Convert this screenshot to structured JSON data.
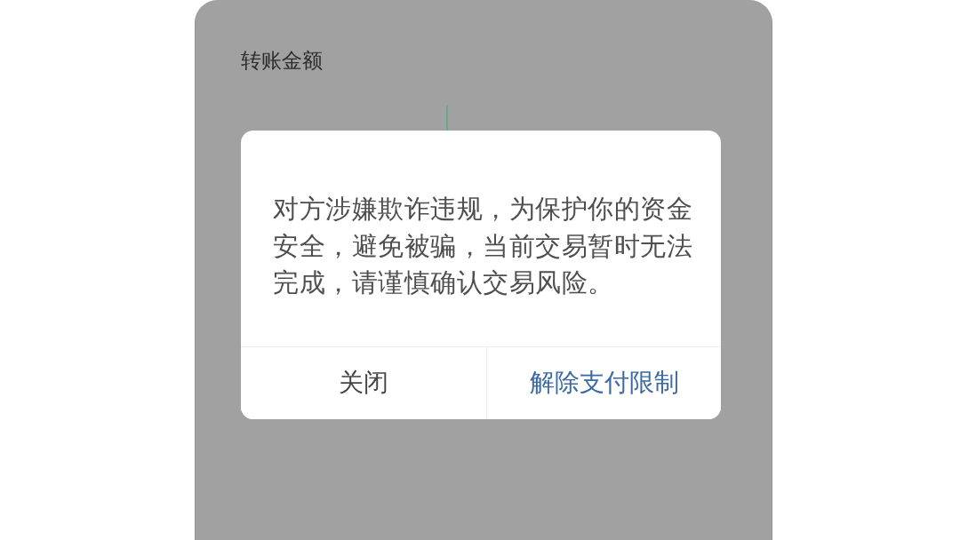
{
  "screen": {
    "field_label": "转账金额",
    "amount": {
      "cursor": true
    }
  },
  "dialog": {
    "message": "对方涉嫌欺诈违规，为保护你的资金安全，避免被骗，当前交易暂时无法完成，请谨慎确认交易风险。",
    "buttons": [
      {
        "label": "关闭",
        "kind": "secondary"
      },
      {
        "label": "解除支付限制",
        "kind": "primary"
      }
    ]
  }
}
